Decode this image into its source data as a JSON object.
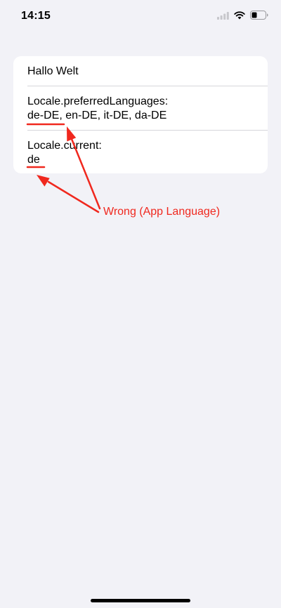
{
  "status_bar": {
    "time": "14:15"
  },
  "card": {
    "row1": {
      "text": "Hallo Welt"
    },
    "row2": {
      "label": "Locale.preferredLanguages:",
      "value": "de-DE, en-DE, it-DE, da-DE"
    },
    "row3": {
      "label": "Locale.current:",
      "value": "de"
    }
  },
  "annotation": {
    "text": "Wrong (App Language)",
    "color": "#f0281e"
  },
  "icons": [
    "signal-icon",
    "wifi-icon",
    "battery-icon"
  ]
}
